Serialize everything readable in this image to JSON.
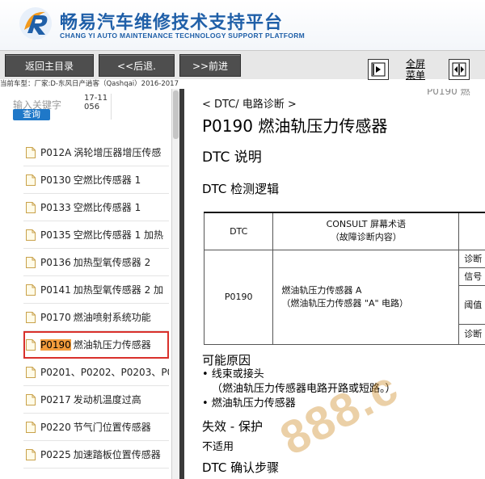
{
  "header": {
    "brand_cn": "畅易汽车维修技术支持平台",
    "brand_en": "CHANG YI AUTO MAINTENANCE TECHNOLOGY SUPPORT PLATFORM",
    "logo_icon": "cy-logo-icon"
  },
  "toolbar": {
    "home_label": "返回主目录",
    "back_label": "<<后退.",
    "forward_label": ">>前进",
    "fullscreen_line1": "全屏",
    "fullscreen_line2": "菜单"
  },
  "vehicle_info": "当前车型：厂家:D-东风日产逍客（Qashqai）2016-2017",
  "search": {
    "label": "输入关键字",
    "value": "17-11056",
    "button": "查询"
  },
  "dtc_list": [
    {
      "code": "P012A",
      "name": "涡轮增压器增压传感"
    },
    {
      "code": "P0130",
      "name": "空燃比传感器 1"
    },
    {
      "code": "P0133",
      "name": "空燃比传感器 1"
    },
    {
      "code": "P0135",
      "name": "空燃比传感器 1 加热"
    },
    {
      "code": "P0136",
      "name": "加热型氧传感器 2"
    },
    {
      "code": "P0141",
      "name": "加热型氧传感器 2 加"
    },
    {
      "code": "P0170",
      "name": "燃油喷射系统功能"
    },
    {
      "code": "P0190",
      "name": "燃油轨压力传感器",
      "selected": true
    },
    {
      "code": "P0201、P0202、P0203、P0",
      "name": ""
    },
    {
      "code": "P0217",
      "name": "发动机温度过高"
    },
    {
      "code": "P0220",
      "name": "节气门位置传感器"
    },
    {
      "code": "P0225",
      "name": "加速踏板位置传感器"
    }
  ],
  "document": {
    "prev_page_tail": "P0190 燃",
    "breadcrumb": "< DTC/ 电路诊断 >",
    "title": "P0190 燃油轨压力传感器",
    "sec_dtc_desc": "DTC 说明",
    "sec_logic": "DTC 检测逻辑",
    "table": {
      "col_dtc": "DTC",
      "col_consult_1": "CONSULT 屏幕术语",
      "col_consult_2": "（故障诊断内容）",
      "code": "P0190",
      "term_1": "燃油轨压力传感器 A",
      "term_2": "（燃油轨压力传感器 \"A\" 电路）",
      "cond_1": "诊断",
      "cond_2": "信号",
      "cond_3": "阈值",
      "cond_4": "诊断"
    },
    "sec_causes": "可能原因",
    "cause_1": "• 线束或接头",
    "cause_2": "（燃油轨压力传感器电路开路或短路。）",
    "cause_3": "• 燃油轨压力传感器",
    "sec_failsafe": "失效 - 保护",
    "failsafe_value": "不适用",
    "sec_confirm": "DTC 确认步骤",
    "watermark": "888.c"
  },
  "colors": {
    "brand_blue": "#1f5fa8",
    "selected_border": "#d9302b",
    "selected_code_bg": "#f39c3c",
    "query_button": "#1f78c8",
    "nav_button": "#4e4e4e"
  }
}
